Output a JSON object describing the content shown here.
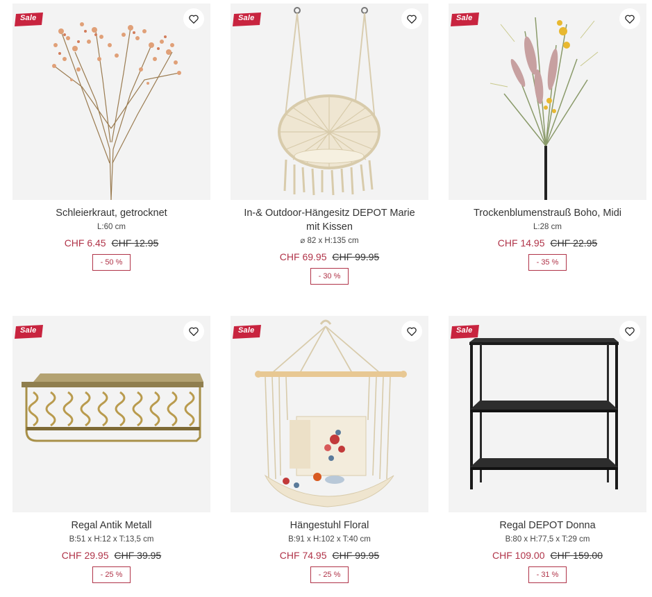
{
  "badge_label": "Sale",
  "colors": {
    "accent": "#b03348",
    "image_bg": "#f3f3f3"
  },
  "products": [
    {
      "title": "Schleierkraut, getrocknet",
      "dims": "L:60 cm",
      "price": "CHF 6.45",
      "old_price": "CHF 12.95",
      "discount": "- 50 %"
    },
    {
      "title": "In-& Outdoor-Hängesitz DEPOT Marie mit Kissen",
      "dims": "⌀ 82 x H:135 cm",
      "price": "CHF 69.95",
      "old_price": "CHF 99.95",
      "discount": "- 30 %"
    },
    {
      "title": "Trockenblumenstrauß Boho, Midi",
      "dims": "L:28 cm",
      "price": "CHF 14.95",
      "old_price": "CHF 22.95",
      "discount": "- 35 %"
    },
    {
      "title": "Regal Antik Metall",
      "dims": "B:51 x H:12 x T:13,5 cm",
      "price": "CHF 29.95",
      "old_price": "CHF 39.95",
      "discount": "- 25 %"
    },
    {
      "title": "Hängestuhl Floral",
      "dims": "B:91 x H:102 x T:40 cm",
      "price": "CHF 74.95",
      "old_price": "CHF 99.95",
      "discount": "- 25 %"
    },
    {
      "title": "Regal DEPOT Donna",
      "dims": "B:80 x H:77,5 x T:29 cm",
      "price": "CHF 109.00",
      "old_price": "CHF 159.00",
      "discount": "- 31 %"
    }
  ]
}
